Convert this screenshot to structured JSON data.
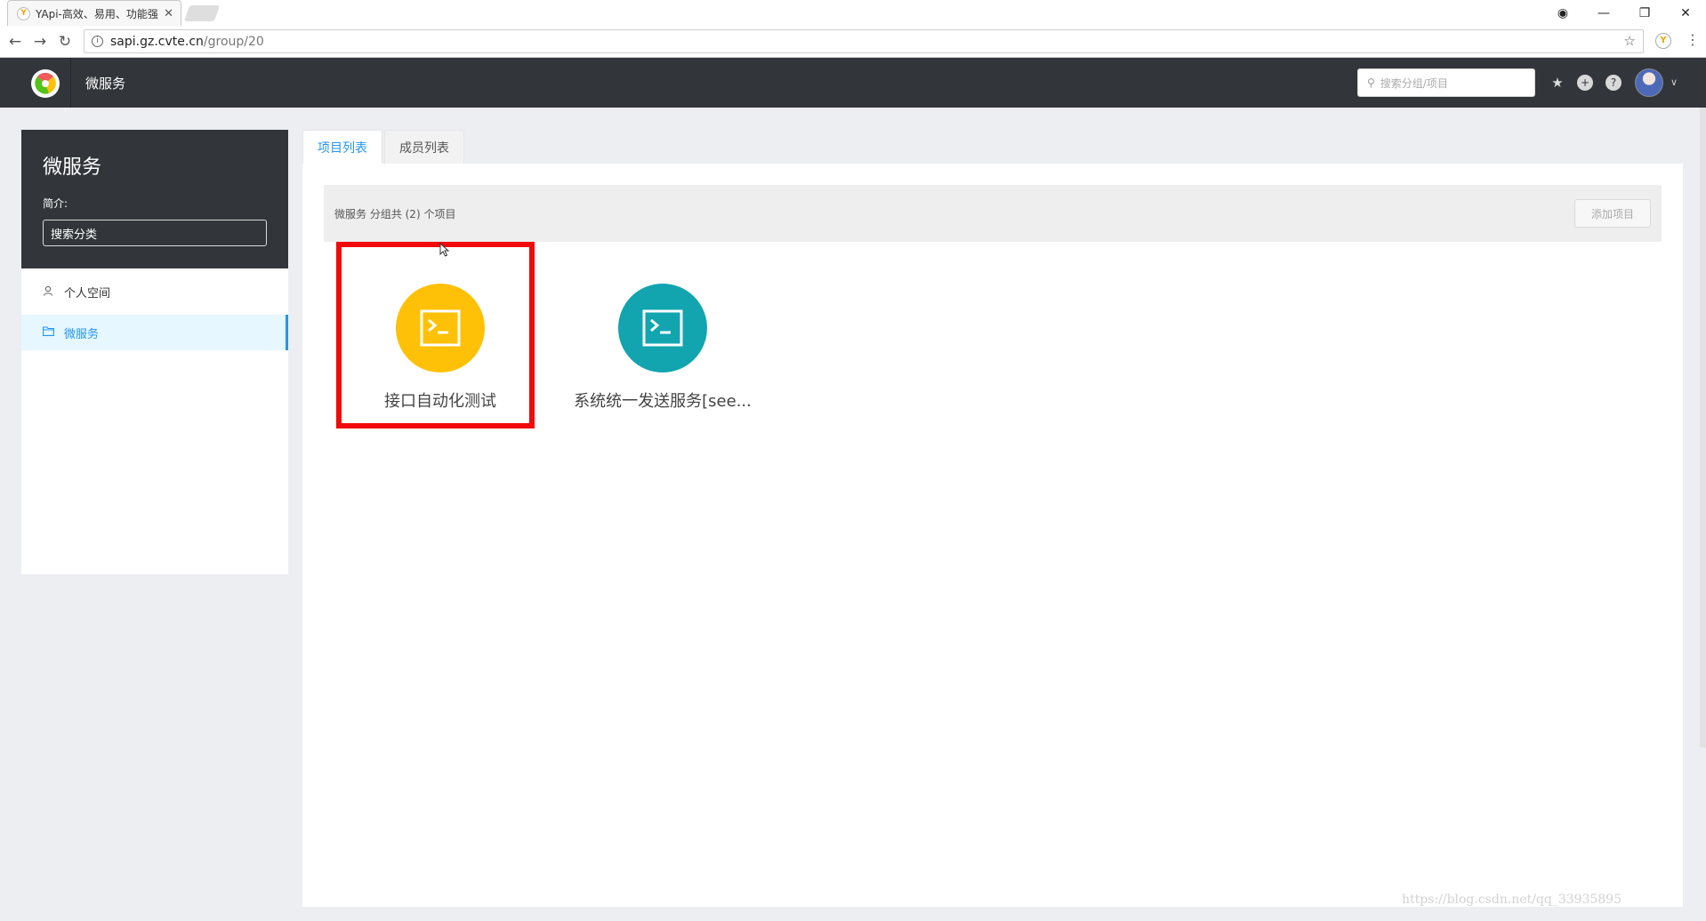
{
  "browser": {
    "tab_title": "YApi-高效、易用、功能强",
    "url_host": "sapi.gz.cvte.cn",
    "url_path": "/group/20"
  },
  "header": {
    "title": "微服务",
    "search_placeholder": "搜索分组/项目"
  },
  "sidebar": {
    "group_name": "微服务",
    "desc_label": "简介:",
    "category_search": "搜索分类",
    "items": [
      {
        "label": "个人空间",
        "icon": "user-icon"
      },
      {
        "label": "微服务",
        "icon": "folder-icon",
        "active": true
      }
    ]
  },
  "tabs": [
    {
      "label": "项目列表",
      "active": true
    },
    {
      "label": "成员列表",
      "active": false
    }
  ],
  "summary": {
    "text": "微服务 分组共 (2) 个项目",
    "add_label": "添加项目"
  },
  "projects": [
    {
      "name": "接口自动化测试",
      "color": "#ffc107",
      "icon": "terminal-icon"
    },
    {
      "name": "系统统一发送服务[see...",
      "color": "#12a5b0",
      "icon": "terminal-icon"
    }
  ],
  "colors": {
    "accent": "#2395f1",
    "header_bg": "#32363a",
    "highlight": "#f00a0a"
  },
  "watermark": "https://blog.csdn.net/qq_33935895"
}
